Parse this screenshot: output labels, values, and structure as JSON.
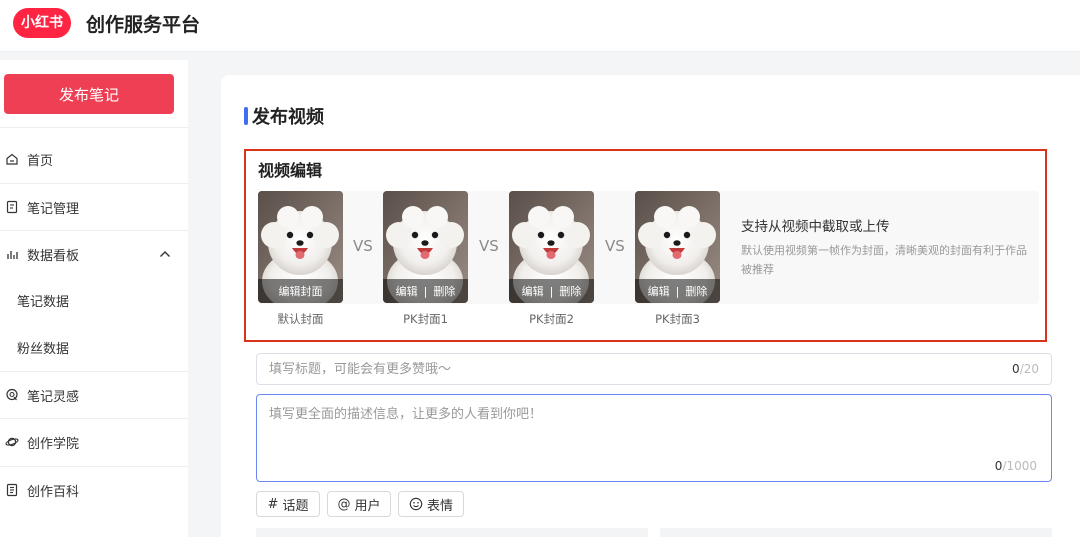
{
  "header": {
    "logo_text": "小红书",
    "app_title": "创作服务平台",
    "brand_color": "#ff2442"
  },
  "sidebar": {
    "publish_label": "发布笔记",
    "items": [
      {
        "label": "首页",
        "icon": "home-icon"
      },
      {
        "label": "笔记管理",
        "icon": "note-icon"
      },
      {
        "label": "数据看板",
        "icon": "bar-chart-icon"
      },
      {
        "label": "笔记数据"
      },
      {
        "label": "粉丝数据"
      },
      {
        "label": "笔记灵感",
        "icon": "bulb-icon"
      },
      {
        "label": "创作学院",
        "icon": "planet-icon"
      },
      {
        "label": "创作百科",
        "icon": "book-icon"
      }
    ]
  },
  "main": {
    "section_title": "发布视频",
    "accent_color": "#3e6ef1",
    "video_edit": {
      "label": "视频编辑",
      "highlight_color": "#d9331c",
      "covers": [
        {
          "caption": "默认封面",
          "action": "编辑封面"
        },
        {
          "caption": "PK封面1",
          "edit": "编辑",
          "delete": "删除"
        },
        {
          "caption": "PK封面2",
          "edit": "编辑",
          "delete": "删除"
        },
        {
          "caption": "PK封面3",
          "edit": "编辑",
          "delete": "删除"
        }
      ],
      "vs_label": "VS",
      "separator": "|",
      "hint_title": "支持从视频中截取或上传",
      "hint_text": "默认使用视频第一帧作为封面，清晰美观的封面有利于作品被推荐"
    },
    "title_field": {
      "placeholder": "填写标题，可能会有更多赞哦～",
      "count": "0",
      "max": "/20"
    },
    "desc_field": {
      "placeholder": "填写更全面的描述信息，让更多的人看到你吧！",
      "count": "0",
      "max": "/1000"
    },
    "chips": [
      {
        "label": "话题",
        "icon": "hash-icon",
        "glyph": "#"
      },
      {
        "label": "用户",
        "icon": "at-icon",
        "glyph": "@"
      },
      {
        "label": "表情",
        "icon": "smiley-icon"
      }
    ]
  }
}
